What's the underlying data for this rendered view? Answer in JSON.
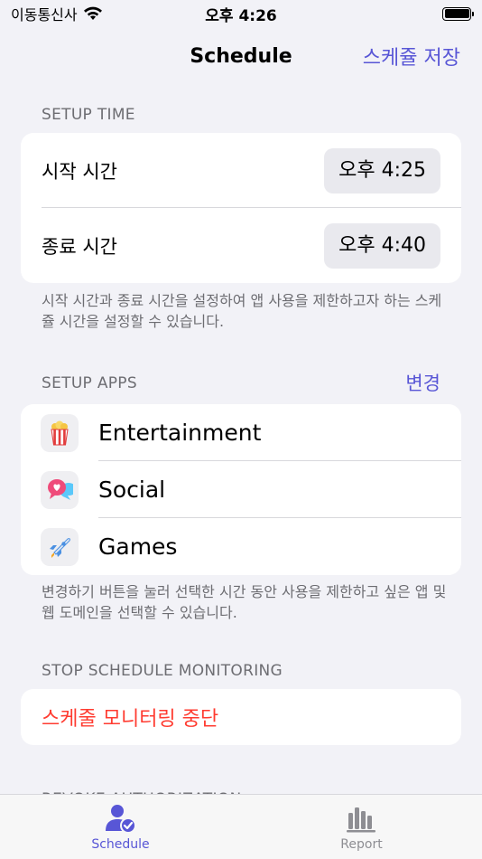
{
  "status_bar": {
    "carrier": "이동통신사",
    "time": "오후 4:26"
  },
  "nav": {
    "title": "Schedule",
    "save_label": "스케쥴 저장"
  },
  "setup_time": {
    "header": "SETUP TIME",
    "start_label": "시작 시간",
    "start_value": "오후 4:25",
    "end_label": "종료 시간",
    "end_value": "오후 4:40",
    "footer": "시작 시간과 종료 시간을 설정하여 앱 사용을 제한하고자 하는 스케쥴 시간을 설정할 수 있습니다."
  },
  "setup_apps": {
    "header": "SETUP APPS",
    "change_label": "변경",
    "items": [
      {
        "label": "Entertainment",
        "icon": "popcorn-icon"
      },
      {
        "label": "Social",
        "icon": "chat-bubbles-icon"
      },
      {
        "label": "Games",
        "icon": "rocket-icon"
      }
    ],
    "footer": "변경하기 버튼을 눌러 선택한 시간 동안 사용을 제한하고 싶은 앱 및 웹 도메인을 선택할 수 있습니다."
  },
  "stop_monitoring": {
    "header": "STOP SCHEDULE MONITORING",
    "action_label": "스케줄 모니터링 중단"
  },
  "revoke": {
    "header": "REVOKE AUTHORIZATION"
  },
  "tab_bar": {
    "tabs": [
      {
        "label": "Schedule",
        "active": true
      },
      {
        "label": "Report",
        "active": false
      }
    ]
  },
  "colors": {
    "accent": "#5856d6",
    "destructive": "#ff3b30",
    "background": "#f2f2f7"
  }
}
